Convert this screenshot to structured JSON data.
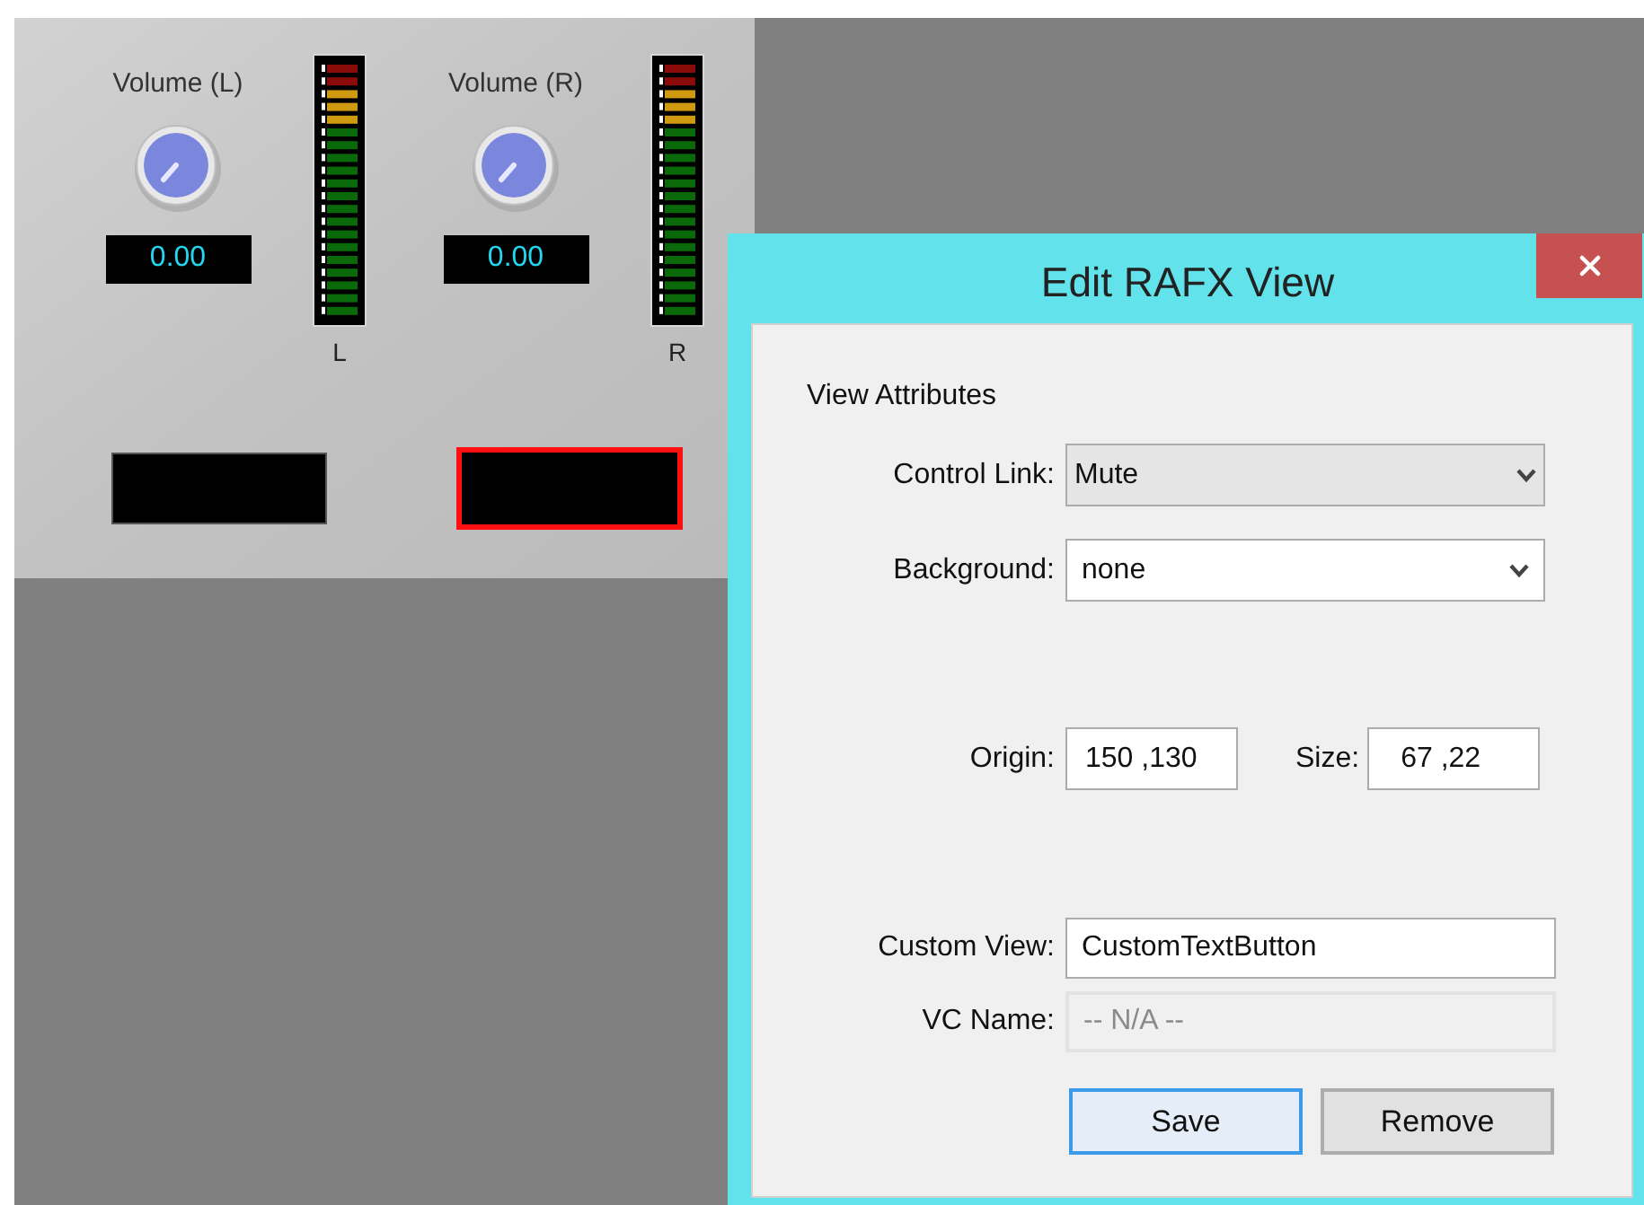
{
  "plugin": {
    "channels": [
      {
        "label": "Volume (L)",
        "value": "0.00",
        "meter_label": "L"
      },
      {
        "label": "Volume (R)",
        "value": "0.00",
        "meter_label": "R"
      }
    ],
    "views": [
      {
        "selected": false
      },
      {
        "selected": true
      }
    ]
  },
  "dialog": {
    "title": "Edit RAFX View",
    "section": "View Attributes",
    "control_link": {
      "label": "Control Link:",
      "value": "Mute"
    },
    "background": {
      "label": "Background:",
      "value": "none"
    },
    "origin": {
      "label": "Origin:",
      "value": "150 ,130"
    },
    "size": {
      "label": "Size:",
      "value": "67 ,22"
    },
    "custom_view": {
      "label": "Custom View:",
      "value": "CustomTextButton",
      "disabled": false
    },
    "vc_name": {
      "label": "VC Name:",
      "value": "-- N/A --",
      "disabled": true
    },
    "buttons": [
      {
        "label": "Save",
        "focused": true
      },
      {
        "label": "Remove",
        "focused": false
      }
    ]
  }
}
